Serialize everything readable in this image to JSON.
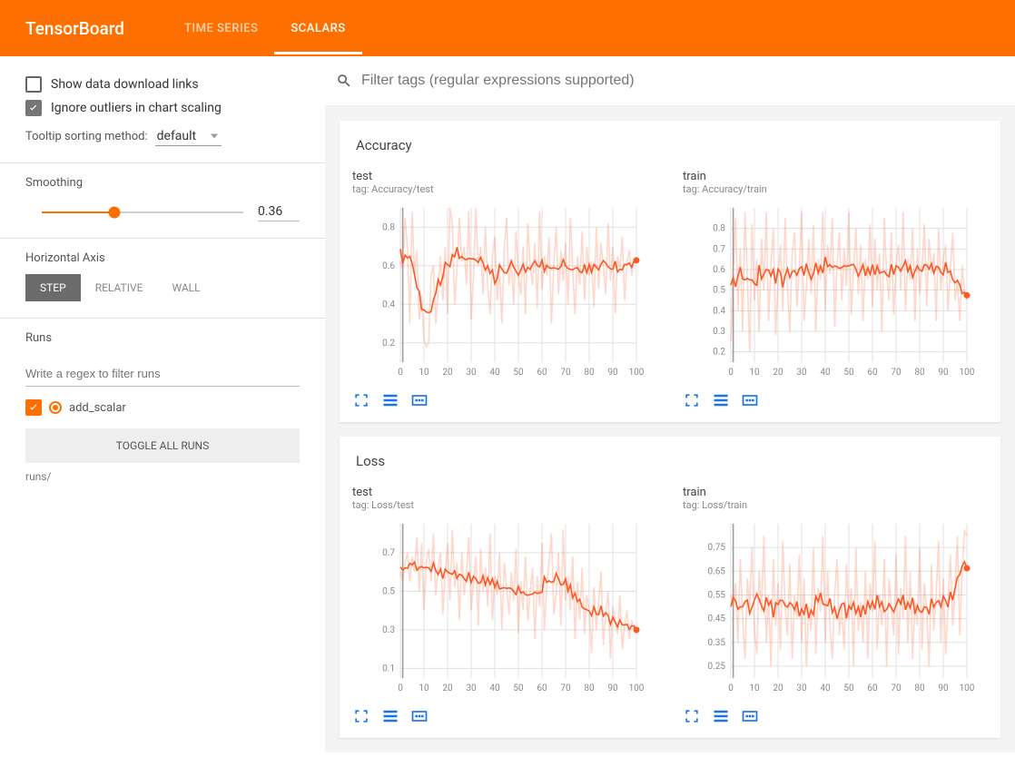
{
  "header": {
    "title": "TensorBoard",
    "tabs": [
      {
        "label": "TIME SERIES",
        "active": false
      },
      {
        "label": "SCALARS",
        "active": true
      }
    ]
  },
  "sidebar": {
    "options": {
      "show_download_links": {
        "label": "Show data download links",
        "checked": false
      },
      "ignore_outliers": {
        "label": "Ignore outliers in chart scaling",
        "checked": true
      }
    },
    "tooltip_sorting": {
      "label": "Tooltip sorting method:",
      "value": "default"
    },
    "smoothing": {
      "label": "Smoothing",
      "value": "0.36",
      "fraction": 0.36
    },
    "horizontal_axis": {
      "label": "Horizontal Axis",
      "buttons": [
        {
          "label": "STEP",
          "active": true
        },
        {
          "label": "RELATIVE",
          "active": false
        },
        {
          "label": "WALL",
          "active": false
        }
      ]
    },
    "runs": {
      "label": "Runs",
      "filter_placeholder": "Write a regex to filter runs",
      "items": [
        {
          "name": "add_scalar",
          "checked": true
        }
      ],
      "toggle_all_label": "TOGGLE ALL RUNS",
      "root": "runs/"
    }
  },
  "content": {
    "filter_placeholder": "Filter tags (regular expressions supported)",
    "groups": [
      {
        "title": "Accuracy",
        "charts": [
          {
            "title": "test",
            "tag": "tag: Accuracy/test",
            "key": "accuracy_test"
          },
          {
            "title": "train",
            "tag": "tag: Accuracy/train",
            "key": "accuracy_train"
          }
        ]
      },
      {
        "title": "Loss",
        "charts": [
          {
            "title": "test",
            "tag": "tag: Loss/test",
            "key": "loss_test"
          },
          {
            "title": "train",
            "tag": "tag: Loss/train",
            "key": "loss_train"
          }
        ]
      }
    ]
  },
  "chart_data": [
    {
      "key": "accuracy_test",
      "type": "line",
      "title": "test",
      "xlabel": "",
      "ylabel": "",
      "x_ticks": [
        0,
        10,
        20,
        30,
        40,
        50,
        60,
        70,
        80,
        90,
        100
      ],
      "y_ticks": [
        0.2,
        0.4,
        0.6,
        0.8
      ],
      "xlim": [
        0,
        100
      ],
      "ylim": [
        0.1,
        0.9
      ],
      "annotations": [
        "tag: Accuracy/test"
      ],
      "series": [
        {
          "name": "add_scalar",
          "x": [
            0,
            1,
            2,
            3,
            4,
            5,
            6,
            7,
            8,
            9,
            10,
            11,
            12,
            13,
            14,
            15,
            16,
            17,
            18,
            19,
            20,
            21,
            22,
            23,
            24,
            25,
            26,
            27,
            28,
            29,
            30,
            31,
            32,
            33,
            34,
            35,
            36,
            37,
            38,
            39,
            40,
            41,
            42,
            43,
            44,
            45,
            46,
            47,
            48,
            49,
            50,
            51,
            52,
            53,
            54,
            55,
            56,
            57,
            58,
            59,
            60,
            61,
            62,
            63,
            64,
            65,
            66,
            67,
            68,
            69,
            70,
            71,
            72,
            73,
            74,
            75,
            76,
            77,
            78,
            79,
            80,
            81,
            82,
            83,
            84,
            85,
            86,
            87,
            88,
            89,
            90,
            91,
            92,
            93,
            94,
            95,
            96,
            97,
            98,
            99,
            100
          ],
          "values": [
            0.62,
            0.58,
            0.85,
            0.7,
            0.3,
            0.88,
            0.55,
            0.68,
            0.32,
            0.45,
            0.22,
            0.18,
            0.2,
            0.55,
            0.6,
            0.3,
            0.48,
            0.65,
            0.42,
            0.7,
            0.35,
            0.9,
            0.82,
            0.4,
            0.58,
            0.85,
            0.62,
            0.7,
            0.5,
            0.88,
            0.32,
            0.55,
            0.9,
            0.6,
            0.7,
            0.45,
            0.8,
            0.5,
            0.35,
            0.65,
            0.75,
            0.42,
            0.58,
            0.3,
            0.68,
            0.85,
            0.5,
            0.62,
            0.4,
            0.78,
            0.55,
            0.45,
            0.7,
            0.35,
            0.82,
            0.6,
            0.5,
            0.72,
            0.38,
            0.88,
            0.48,
            0.65,
            0.55,
            0.75,
            0.3,
            0.6,
            0.8,
            0.45,
            0.68,
            0.52,
            0.72,
            0.4,
            0.85,
            0.58,
            0.35,
            0.65,
            0.5,
            0.78,
            0.42,
            0.7,
            0.55,
            0.62,
            0.38,
            0.8,
            0.48,
            0.72,
            0.6,
            0.45,
            0.82,
            0.52,
            0.7,
            0.35,
            0.65,
            0.58,
            0.75,
            0.42,
            0.62,
            0.68,
            0.55,
            0.64,
            0.64
          ]
        }
      ]
    },
    {
      "key": "accuracy_train",
      "type": "line",
      "title": "train",
      "xlabel": "",
      "ylabel": "",
      "x_ticks": [
        0,
        10,
        20,
        30,
        40,
        50,
        60,
        70,
        80,
        90,
        100
      ],
      "y_ticks": [
        0.2,
        0.3,
        0.4,
        0.5,
        0.6,
        0.7,
        0.8
      ],
      "xlim": [
        0,
        100
      ],
      "ylim": [
        0.15,
        0.9
      ],
      "annotations": [
        "tag: Accuracy/train"
      ],
      "series": [
        {
          "name": "add_scalar",
          "x": [
            0,
            1,
            2,
            3,
            4,
            5,
            6,
            7,
            8,
            9,
            10,
            11,
            12,
            13,
            14,
            15,
            16,
            17,
            18,
            19,
            20,
            21,
            22,
            23,
            24,
            25,
            26,
            27,
            28,
            29,
            30,
            31,
            32,
            33,
            34,
            35,
            36,
            37,
            38,
            39,
            40,
            41,
            42,
            43,
            44,
            45,
            46,
            47,
            48,
            49,
            50,
            51,
            52,
            53,
            54,
            55,
            56,
            57,
            58,
            59,
            60,
            61,
            62,
            63,
            64,
            65,
            66,
            67,
            68,
            69,
            70,
            71,
            72,
            73,
            74,
            75,
            76,
            77,
            78,
            79,
            80,
            81,
            82,
            83,
            84,
            85,
            86,
            87,
            88,
            89,
            90,
            91,
            92,
            93,
            94,
            95,
            96,
            97,
            98,
            99,
            100
          ],
          "values": [
            0.25,
            0.6,
            0.85,
            0.4,
            0.7,
            0.3,
            0.88,
            0.55,
            0.2,
            0.82,
            0.45,
            0.65,
            0.3,
            0.75,
            0.5,
            0.88,
            0.35,
            0.62,
            0.8,
            0.28,
            0.55,
            0.72,
            0.4,
            0.85,
            0.5,
            0.3,
            0.68,
            0.78,
            0.42,
            0.6,
            0.88,
            0.35,
            0.52,
            0.75,
            0.48,
            0.82,
            0.3,
            0.65,
            0.55,
            0.88,
            0.4,
            0.72,
            0.58,
            0.85,
            0.32,
            0.62,
            0.78,
            0.45,
            0.7,
            0.52,
            0.88,
            0.38,
            0.6,
            0.8,
            0.48,
            0.72,
            0.35,
            0.65,
            0.55,
            0.82,
            0.42,
            0.75,
            0.5,
            0.68,
            0.3,
            0.85,
            0.58,
            0.45,
            0.78,
            0.38,
            0.62,
            0.72,
            0.5,
            0.88,
            0.4,
            0.65,
            0.55,
            0.8,
            0.35,
            0.7,
            0.48,
            0.62,
            0.82,
            0.42,
            0.75,
            0.58,
            0.68,
            0.35,
            0.8,
            0.5,
            0.65,
            0.72,
            0.4,
            0.6,
            0.78,
            0.45,
            0.55,
            0.35,
            0.62,
            0.48,
            0.45
          ]
        }
      ]
    },
    {
      "key": "loss_test",
      "type": "line",
      "title": "test",
      "xlabel": "",
      "ylabel": "",
      "x_ticks": [
        0,
        10,
        20,
        30,
        40,
        50,
        60,
        70,
        80,
        90,
        100
      ],
      "y_ticks": [
        0.1,
        0.3,
        0.5,
        0.7
      ],
      "xlim": [
        0,
        100
      ],
      "ylim": [
        0.05,
        0.85
      ],
      "annotations": [
        "tag: Loss/test"
      ],
      "series": [
        {
          "name": "add_scalar",
          "x": [
            0,
            1,
            2,
            3,
            4,
            5,
            6,
            7,
            8,
            9,
            10,
            11,
            12,
            13,
            14,
            15,
            16,
            17,
            18,
            19,
            20,
            21,
            22,
            23,
            24,
            25,
            26,
            27,
            28,
            29,
            30,
            31,
            32,
            33,
            34,
            35,
            36,
            37,
            38,
            39,
            40,
            41,
            42,
            43,
            44,
            45,
            46,
            47,
            48,
            49,
            50,
            51,
            52,
            53,
            54,
            55,
            56,
            57,
            58,
            59,
            60,
            61,
            62,
            63,
            64,
            65,
            66,
            67,
            68,
            69,
            70,
            71,
            72,
            73,
            74,
            75,
            76,
            77,
            78,
            79,
            80,
            81,
            82,
            83,
            84,
            85,
            86,
            87,
            88,
            89,
            90,
            91,
            92,
            93,
            94,
            95,
            96,
            97,
            98,
            99,
            100
          ],
          "values": [
            0.6,
            0.55,
            0.65,
            0.7,
            0.55,
            0.68,
            0.6,
            0.78,
            0.5,
            0.75,
            0.4,
            0.65,
            0.72,
            0.55,
            0.8,
            0.48,
            0.62,
            0.7,
            0.38,
            0.58,
            0.75,
            0.45,
            0.82,
            0.52,
            0.65,
            0.35,
            0.7,
            0.48,
            0.6,
            0.78,
            0.4,
            0.55,
            0.68,
            0.32,
            0.72,
            0.5,
            0.62,
            0.42,
            0.8,
            0.35,
            0.58,
            0.48,
            0.7,
            0.3,
            0.65,
            0.52,
            0.38,
            0.6,
            0.45,
            0.72,
            0.28,
            0.55,
            0.4,
            0.68,
            0.35,
            0.5,
            0.62,
            0.25,
            0.58,
            0.42,
            0.75,
            0.3,
            0.52,
            0.65,
            0.8,
            0.38,
            0.48,
            0.7,
            0.32,
            0.82,
            0.45,
            0.58,
            0.4,
            0.68,
            0.25,
            0.55,
            0.35,
            0.62,
            0.28,
            0.48,
            0.4,
            0.18,
            0.52,
            0.3,
            0.45,
            0.6,
            0.22,
            0.38,
            0.5,
            0.15,
            0.42,
            0.35,
            0.28,
            0.48,
            0.2,
            0.32,
            0.4,
            0.25,
            0.35,
            0.3,
            0.3
          ]
        }
      ]
    },
    {
      "key": "loss_train",
      "type": "line",
      "title": "train",
      "xlabel": "",
      "ylabel": "",
      "x_ticks": [
        0,
        10,
        20,
        30,
        40,
        50,
        60,
        70,
        80,
        90,
        100
      ],
      "y_ticks": [
        0.25,
        0.35,
        0.45,
        0.55,
        0.65,
        0.75
      ],
      "xlim": [
        0,
        100
      ],
      "ylim": [
        0.2,
        0.85
      ],
      "annotations": [
        "tag: Loss/train"
      ],
      "series": [
        {
          "name": "add_scalar",
          "x": [
            0,
            1,
            2,
            3,
            4,
            5,
            6,
            7,
            8,
            9,
            10,
            11,
            12,
            13,
            14,
            15,
            16,
            17,
            18,
            19,
            20,
            21,
            22,
            23,
            24,
            25,
            26,
            27,
            28,
            29,
            30,
            31,
            32,
            33,
            34,
            35,
            36,
            37,
            38,
            39,
            40,
            41,
            42,
            43,
            44,
            45,
            46,
            47,
            48,
            49,
            50,
            51,
            52,
            53,
            54,
            55,
            56,
            57,
            58,
            59,
            60,
            61,
            62,
            63,
            64,
            65,
            66,
            67,
            68,
            69,
            70,
            71,
            72,
            73,
            74,
            75,
            76,
            77,
            78,
            79,
            80,
            81,
            82,
            83,
            84,
            85,
            86,
            87,
            88,
            89,
            90,
            91,
            92,
            93,
            94,
            95,
            96,
            97,
            98,
            99,
            100
          ],
          "values": [
            0.55,
            0.5,
            0.6,
            0.35,
            0.7,
            0.45,
            0.28,
            0.62,
            0.5,
            0.75,
            0.4,
            0.3,
            0.65,
            0.48,
            0.8,
            0.35,
            0.55,
            0.25,
            0.7,
            0.42,
            0.6,
            0.32,
            0.78,
            0.5,
            0.38,
            0.68,
            0.28,
            0.55,
            0.45,
            0.72,
            0.35,
            0.62,
            0.25,
            0.5,
            0.4,
            0.75,
            0.3,
            0.58,
            0.48,
            0.8,
            0.35,
            0.65,
            0.42,
            0.28,
            0.55,
            0.7,
            0.38,
            0.5,
            0.32,
            0.68,
            0.45,
            0.58,
            0.25,
            0.75,
            0.4,
            0.52,
            0.35,
            0.65,
            0.28,
            0.6,
            0.48,
            0.78,
            0.32,
            0.55,
            0.42,
            0.7,
            0.25,
            0.62,
            0.5,
            0.38,
            0.72,
            0.3,
            0.58,
            0.45,
            0.8,
            0.35,
            0.65,
            0.28,
            0.52,
            0.42,
            0.75,
            0.32,
            0.6,
            0.48,
            0.25,
            0.68,
            0.4,
            0.55,
            0.78,
            0.35,
            0.62,
            0.3,
            0.5,
            0.72,
            0.42,
            0.58,
            0.8,
            0.38,
            0.65,
            0.82,
            0.8
          ]
        }
      ]
    }
  ]
}
